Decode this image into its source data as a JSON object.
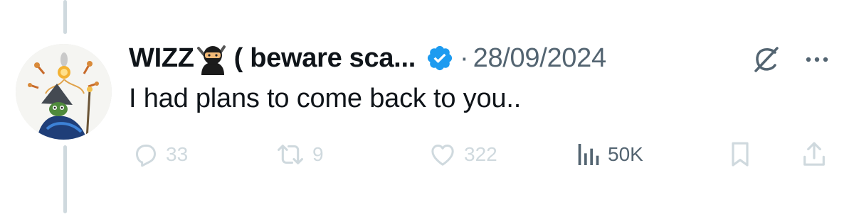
{
  "author": {
    "name": "WIZZ",
    "name_suffix": "( beware sca...",
    "verified": true,
    "date": "28/09/2024"
  },
  "separator": "·",
  "tweet": {
    "text": "I had plans to come back to you.."
  },
  "metrics": {
    "replies": "33",
    "reposts": "9",
    "likes": "322",
    "views": "50K"
  },
  "colors": {
    "verified_badge": "#1d9bf0",
    "text_primary": "#0f1419",
    "text_secondary": "#536471",
    "action_faded": "#cfd9de",
    "thread_line": "#cfd9de"
  },
  "icons": {
    "verified": "verified-badge-icon",
    "ninja": "ninja-emoji-icon",
    "grok": "grok-icon",
    "more": "more-dots-icon",
    "reply": "reply-icon",
    "repost": "repost-icon",
    "like": "heart-icon",
    "views": "views-chart-icon",
    "bookmark": "bookmark-icon",
    "share": "share-icon"
  }
}
